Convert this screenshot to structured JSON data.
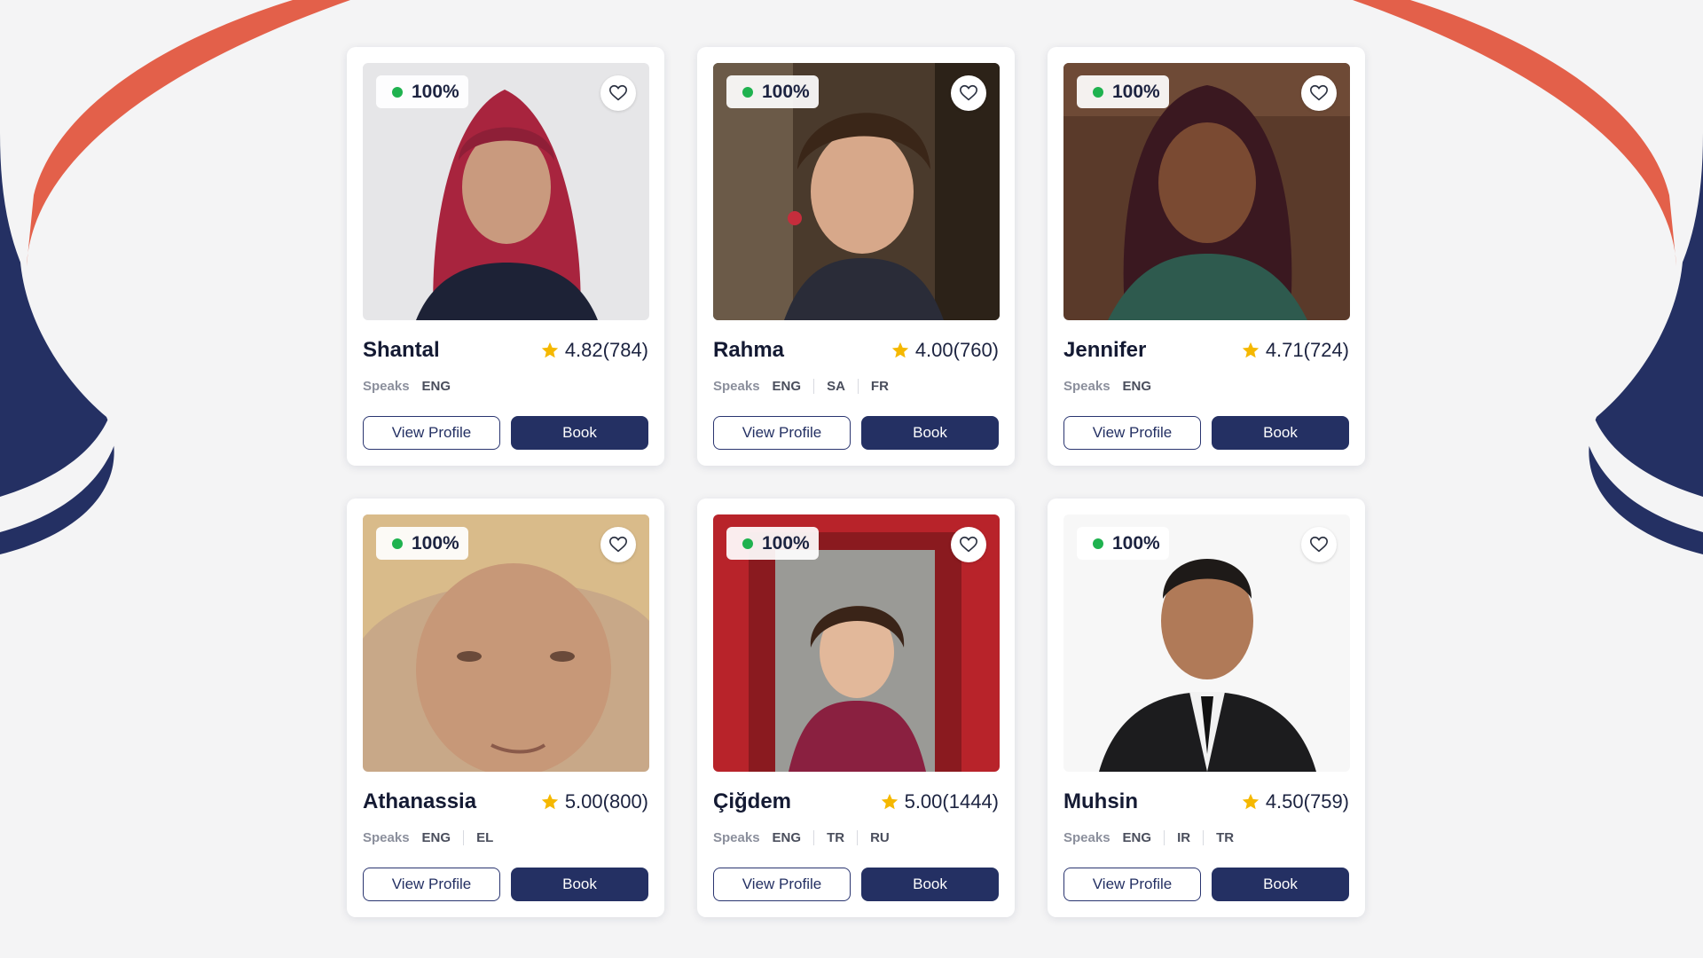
{
  "theme": {
    "navy": "#243063",
    "coral": "#e3604a",
    "online_green": "#1fb24f",
    "star_gold": "#f5b800"
  },
  "labels": {
    "speaks": "Speaks",
    "view_profile": "View Profile",
    "book": "Book"
  },
  "tutors": [
    {
      "name": "Shantal",
      "availability": "100%",
      "rating": "4.82",
      "reviews": "(784)",
      "languages": [
        "ENG"
      ]
    },
    {
      "name": "Rahma",
      "availability": "100%",
      "rating": "4.00",
      "reviews": "(760)",
      "languages": [
        "ENG",
        "SA",
        "FR"
      ]
    },
    {
      "name": "Jennifer",
      "availability": "100%",
      "rating": "4.71",
      "reviews": "(724)",
      "languages": [
        "ENG"
      ]
    },
    {
      "name": "Athanassia",
      "availability": "100%",
      "rating": "5.00",
      "reviews": "(800)",
      "languages": [
        "ENG",
        "EL"
      ]
    },
    {
      "name": "Çiğdem",
      "availability": "100%",
      "rating": "5.00",
      "reviews": "(1444)",
      "languages": [
        "ENG",
        "TR",
        "RU"
      ]
    },
    {
      "name": "Muhsin",
      "availability": "100%",
      "rating": "4.50",
      "reviews": "(759)",
      "languages": [
        "ENG",
        "IR",
        "TR"
      ]
    }
  ]
}
